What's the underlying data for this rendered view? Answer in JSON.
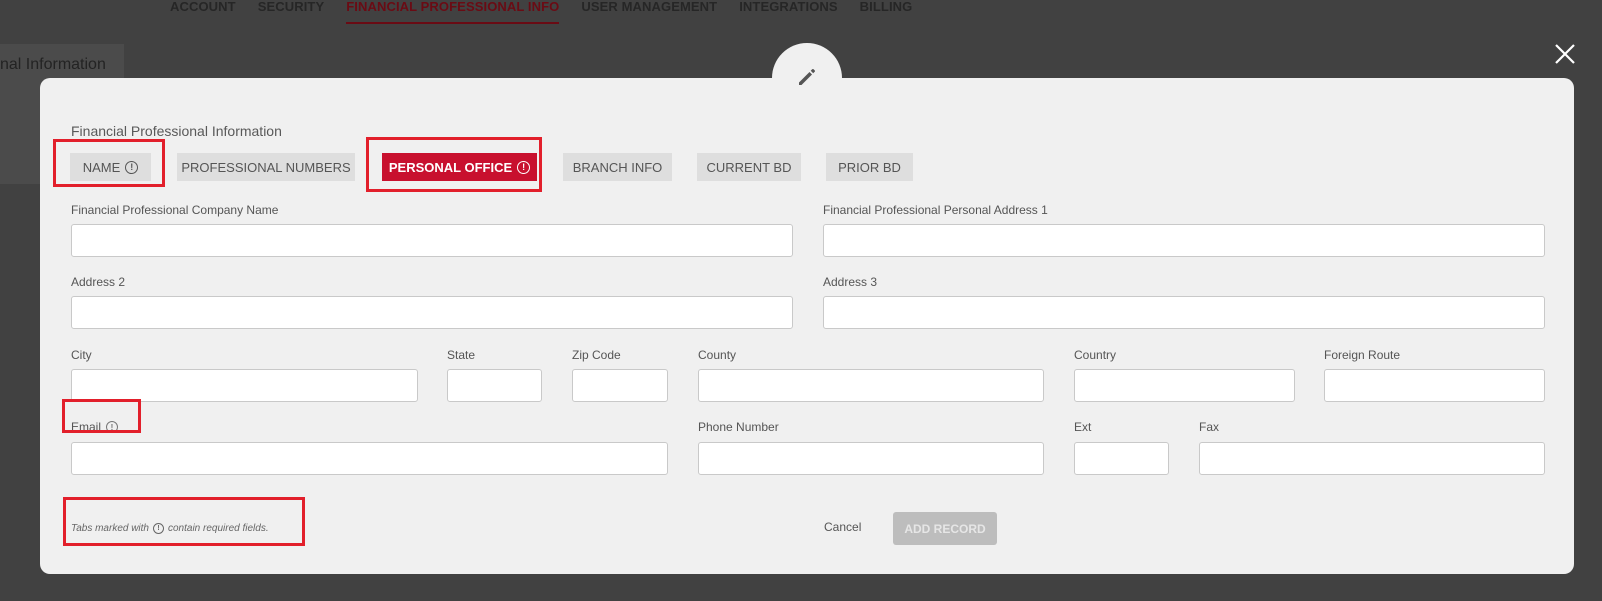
{
  "background": {
    "nav": [
      "ACCOUNT",
      "SECURITY",
      "FINANCIAL PROFESSIONAL INFO",
      "USER MANAGEMENT",
      "INTEGRATIONS",
      "BILLING"
    ],
    "panel_text": "nal Information"
  },
  "modal": {
    "title": "Financial Professional Information",
    "tabs": [
      {
        "label": "NAME",
        "required": true
      },
      {
        "label": "PROFESSIONAL NUMBERS",
        "required": false
      },
      {
        "label": "PERSONAL OFFICE",
        "required": true,
        "active": true
      },
      {
        "label": "BRANCH INFO",
        "required": false
      },
      {
        "label": "CURRENT BD",
        "required": false
      },
      {
        "label": "PRIOR BD",
        "required": false
      }
    ],
    "fields": {
      "company_name": {
        "label": "Financial Professional Company Name",
        "value": ""
      },
      "address1": {
        "label": "Financial Professional Personal Address 1",
        "value": ""
      },
      "address2": {
        "label": "Address 2",
        "value": ""
      },
      "address3": {
        "label": "Address 3",
        "value": ""
      },
      "city": {
        "label": "City",
        "value": ""
      },
      "state": {
        "label": "State",
        "value": ""
      },
      "zip": {
        "label": "Zip Code",
        "value": ""
      },
      "county": {
        "label": "County",
        "value": ""
      },
      "country": {
        "label": "Country",
        "value": ""
      },
      "foreign_route": {
        "label": "Foreign Route",
        "value": ""
      },
      "email": {
        "label": "Email",
        "value": "",
        "required": true
      },
      "phone": {
        "label": "Phone Number",
        "value": ""
      },
      "ext": {
        "label": "Ext",
        "value": ""
      },
      "fax": {
        "label": "Fax",
        "value": ""
      }
    },
    "footnote": {
      "before": "Tabs marked with",
      "after": "contain required fields."
    },
    "cancel_label": "Cancel",
    "add_label": "ADD RECORD",
    "required_icon": "!"
  },
  "colors": {
    "accent": "#c8102e",
    "highlight": "#e21f2b",
    "overlay": "#414141",
    "modal_bg": "#f0f0f0"
  },
  "icons": [
    "pencil-icon",
    "close-icon",
    "required-info-icon"
  ]
}
